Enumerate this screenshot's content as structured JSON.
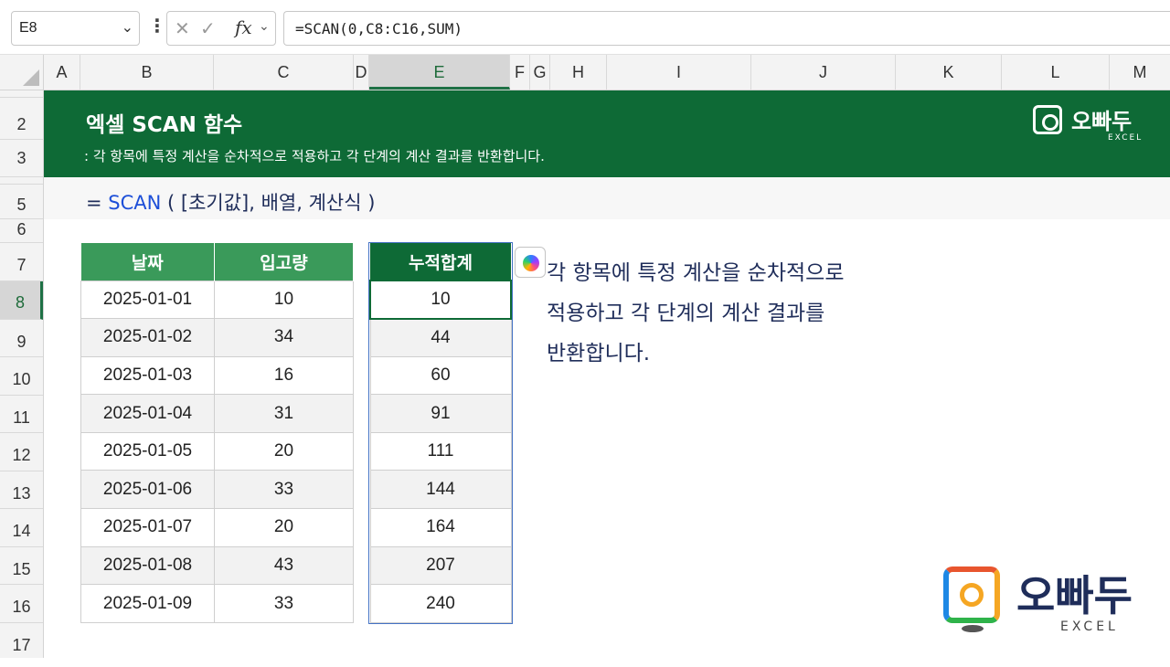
{
  "formula_bar": {
    "name_box": "E8",
    "formula": "=SCAN(0,C8:C16,SUM)",
    "fx_label": "fx",
    "cancel_glyph": "✕",
    "enter_glyph": "✓"
  },
  "columns": [
    "A",
    "B",
    "C",
    "D",
    "E",
    "F",
    "G",
    "H",
    "I",
    "J",
    "K",
    "L",
    "M"
  ],
  "rows": [
    "2",
    "3",
    "5",
    "6",
    "7",
    "8",
    "9",
    "10",
    "11",
    "12",
    "13",
    "14",
    "15",
    "16",
    "17"
  ],
  "banner": {
    "title": "엑셀 SCAN 함수",
    "subtitle": ": 각 항목에 특정 계산을 순차적으로 적용하고 각 단계의 계산 결과를 반환합니다.",
    "brand": "오빠두",
    "brand_sub": "EXCEL"
  },
  "syntax": {
    "prefix": "= ",
    "fn": "SCAN",
    "args": " ( [초기값], 배열, 계산식 )"
  },
  "table1": {
    "headers": [
      "날짜",
      "입고량"
    ],
    "rows": [
      [
        "2025-01-01",
        "10"
      ],
      [
        "2025-01-02",
        "34"
      ],
      [
        "2025-01-03",
        "16"
      ],
      [
        "2025-01-04",
        "31"
      ],
      [
        "2025-01-05",
        "20"
      ],
      [
        "2025-01-06",
        "33"
      ],
      [
        "2025-01-07",
        "20"
      ],
      [
        "2025-01-08",
        "43"
      ],
      [
        "2025-01-09",
        "33"
      ]
    ]
  },
  "table2": {
    "header": "누적합계",
    "values": [
      "10",
      "44",
      "60",
      "91",
      "111",
      "144",
      "164",
      "207",
      "240"
    ]
  },
  "description": {
    "line1": "각 항목에 특정 계산을 순차적으로",
    "line2": "적용하고 각 단계의 계산 결과를",
    "line3": "반환합니다."
  },
  "logo": {
    "name": "오빠두",
    "sub": "EXCEL"
  },
  "colors": {
    "banner": "#0e6a36",
    "table_header": "#3a9a5a",
    "selection": "#1e7145",
    "function_blue": "#1d4fd8",
    "text_navy": "#1f2d5a"
  },
  "icons": {
    "copilot": "copilot-icon",
    "name_box_dropdown": "chevron-down-icon"
  }
}
